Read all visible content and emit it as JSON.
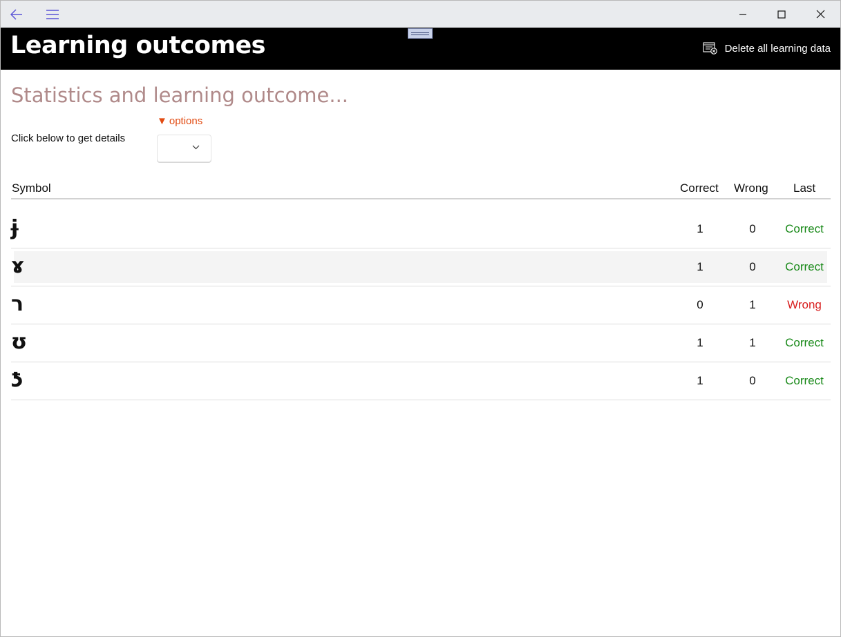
{
  "window": {
    "controls": {
      "minimize_icon": "minimize-icon",
      "maximize_icon": "maximize-icon",
      "close_icon": "close-icon"
    }
  },
  "header": {
    "title": "Learning outcomes",
    "delete_label": "Delete all learning data"
  },
  "content": {
    "subtitle": "Statistics and learning outcome...",
    "details_label": "Click below to get details",
    "options_label": "options",
    "options_marker": "▼",
    "combo_value": ""
  },
  "table": {
    "headers": {
      "symbol": "Symbol",
      "correct": "Correct",
      "wrong": "Wrong",
      "last": "Last"
    },
    "rows": [
      {
        "symbol": "ɉ",
        "correct": "1",
        "wrong": "0",
        "last": "Correct"
      },
      {
        "symbol": "ɤ",
        "correct": "1",
        "wrong": "0",
        "last": "Correct"
      },
      {
        "symbol": "ר",
        "correct": "0",
        "wrong": "1",
        "last": "Wrong"
      },
      {
        "symbol": "ʊ",
        "correct": "1",
        "wrong": "1",
        "last": "Correct"
      },
      {
        "symbol": "ƾ",
        "correct": "1",
        "wrong": "0",
        "last": "Correct"
      }
    ]
  },
  "colors": {
    "header_bg": "#000000",
    "subtitle": "#b08a8a",
    "options": "#e24b12",
    "correct": "#1a8a1a",
    "wrong": "#d81d1d",
    "nav_icons": "#5b55d6"
  }
}
